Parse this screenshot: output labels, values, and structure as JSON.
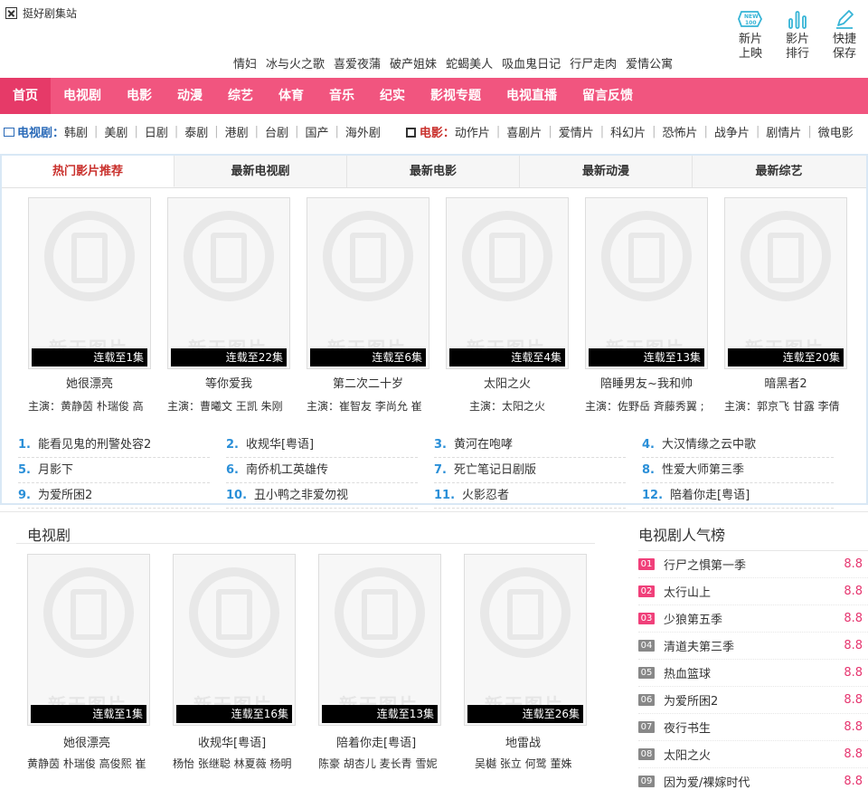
{
  "site": {
    "title": "挺好剧集站"
  },
  "hotwords": [
    "情妇",
    "冰与火之歌",
    "喜爱夜蒲",
    "破产姐妹",
    "蛇蝎美人",
    "吸血鬼日记",
    "行尸走肉",
    "爱情公寓"
  ],
  "quick": [
    {
      "icon": "new100-icon",
      "line1": "新片",
      "line2": "上映"
    },
    {
      "icon": "bar-chart-icon",
      "line1": "影片",
      "line2": "排行"
    },
    {
      "icon": "pencil-icon",
      "line1": "快捷",
      "line2": "保存"
    }
  ],
  "nav": [
    "首页",
    "电视剧",
    "电影",
    "动漫",
    "综艺",
    "体育",
    "音乐",
    "纪实",
    "影视专题",
    "电视直播",
    "留言反馈"
  ],
  "subnav": {
    "tv_label": "电视剧：",
    "tv_items": [
      "韩剧",
      "美剧",
      "日剧",
      "泰剧",
      "港剧",
      "台剧",
      "国产",
      "海外剧"
    ],
    "movie_label": "电影：",
    "movie_items": [
      "动作片",
      "喜剧片",
      "爱情片",
      "科幻片",
      "恐怖片",
      "战争片",
      "剧情片",
      "微电影"
    ]
  },
  "tabs": [
    "热门影片推荐",
    "最新电视剧",
    "最新电影",
    "最新动漫",
    "最新综艺"
  ],
  "watermark": "新天图片",
  "hot_cards": [
    {
      "badge": "连载至1集",
      "title": "她很漂亮",
      "cast": "主演：黄静茵 朴瑞俊 高"
    },
    {
      "badge": "连载至22集",
      "title": "等你爱我",
      "cast": "主演：曹曦文 王凯 朱刚"
    },
    {
      "badge": "连载至6集",
      "title": "第二次二十岁",
      "cast": "主演：崔智友 李尚允 崔"
    },
    {
      "badge": "连载至4集",
      "title": "太阳之火",
      "cast": "主演：太阳之火"
    },
    {
      "badge": "连载至13集",
      "title": "陪睡男友~我和帅",
      "cast": "主演：佐野岳 斉藤秀翼 ;"
    },
    {
      "badge": "连载至20集",
      "title": "暗黑者2",
      "cast": "主演：郭京飞 甘露 李倩"
    }
  ],
  "rank_list": [
    {
      "num": "1.",
      "title": "能看见鬼的刑警处容2"
    },
    {
      "num": "2.",
      "title": "收规华[粤语]"
    },
    {
      "num": "3.",
      "title": "黄河在咆哮"
    },
    {
      "num": "4.",
      "title": "大汉情缘之云中歌"
    },
    {
      "num": "5.",
      "title": "月影下"
    },
    {
      "num": "6.",
      "title": "南侨机工英雄传"
    },
    {
      "num": "7.",
      "title": "死亡笔记日剧版"
    },
    {
      "num": "8.",
      "title": "性爱大师第三季"
    },
    {
      "num": "9.",
      "title": "为爱所困2"
    },
    {
      "num": "10.",
      "title": "丑小鸭之非爱勿视"
    },
    {
      "num": "11.",
      "title": "火影忍者"
    },
    {
      "num": "12.",
      "title": "陪着你走[粤语]"
    }
  ],
  "tv_section": {
    "heading": "电视剧",
    "cards": [
      {
        "badge": "连载至1集",
        "title": "她很漂亮",
        "cast": "黄静茵 朴瑞俊 高俊熙 崔"
      },
      {
        "badge": "连载至16集",
        "title": "收规华[粤语]",
        "cast": "杨怡 张继聪 林夏薇 杨明"
      },
      {
        "badge": "连载至13集",
        "title": "陪着你走[粤语]",
        "cast": "陈豪 胡杏儿 麦长青 雪妮"
      },
      {
        "badge": "连载至26集",
        "title": "地雷战",
        "cast": "吴樾 张立 何鹭 董姝"
      }
    ]
  },
  "popular": {
    "heading": "电视剧人气榜",
    "items": [
      {
        "num": "01",
        "title": "行尸之惧第一季",
        "score": "8.8",
        "color": "#f0407a"
      },
      {
        "num": "02",
        "title": "太行山上",
        "score": "8.8",
        "color": "#f0407a"
      },
      {
        "num": "03",
        "title": "少狼第五季",
        "score": "8.8",
        "color": "#f0407a"
      },
      {
        "num": "04",
        "title": "清道夫第三季",
        "score": "8.8",
        "color": "#888888"
      },
      {
        "num": "05",
        "title": "热血篮球",
        "score": "8.8",
        "color": "#888888"
      },
      {
        "num": "06",
        "title": "为爱所困2",
        "score": "8.8",
        "color": "#888888"
      },
      {
        "num": "07",
        "title": "夜行书生",
        "score": "8.8",
        "color": "#888888"
      },
      {
        "num": "08",
        "title": "太阳之火",
        "score": "8.8",
        "color": "#888888"
      },
      {
        "num": "09",
        "title": "因为爱/裸嫁时代",
        "score": "8.8",
        "color": "#888888"
      }
    ]
  },
  "colors": {
    "nav": "#f1557f",
    "nav_active": "#e63a68",
    "accent_blue": "#2a8fd8",
    "accent_red": "#c9302c",
    "score": "#e6356f"
  }
}
